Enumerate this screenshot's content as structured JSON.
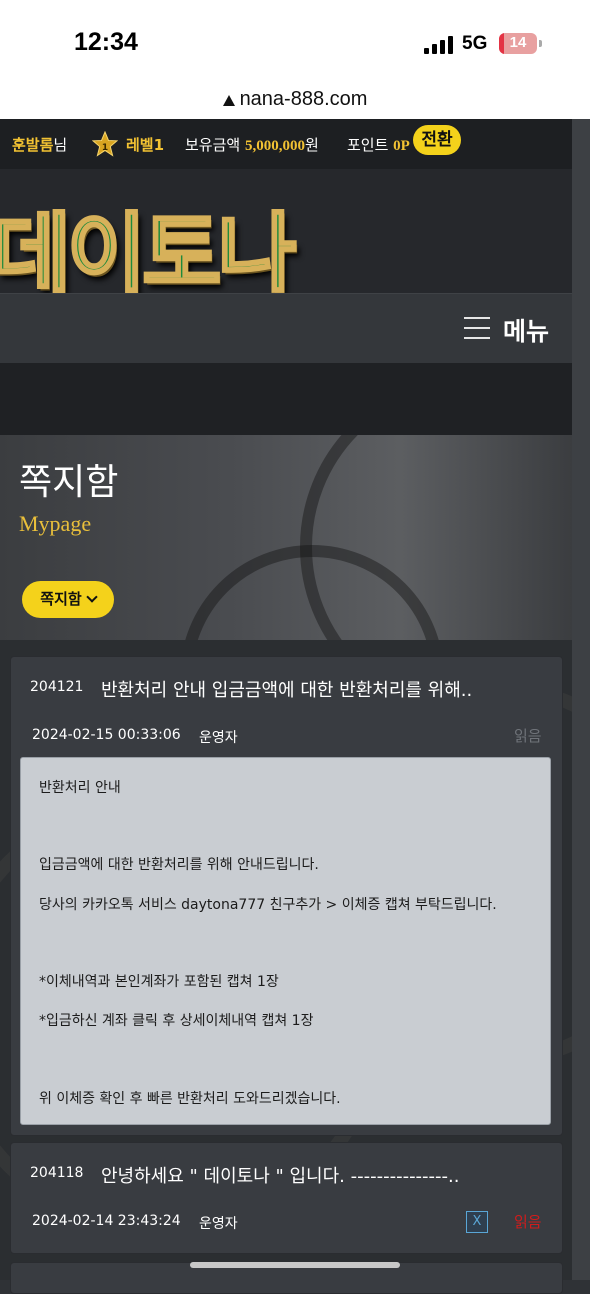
{
  "status_bar": {
    "time": "12:34",
    "network": "5G",
    "battery": "14",
    "battery_level": 0.14,
    "battery_color": "#e33344"
  },
  "browser": {
    "url": "nana-888.com"
  },
  "userbar": {
    "username": "훈발롬",
    "username_suffix": "님",
    "level_badge": "1",
    "level": "레벨1",
    "holding_label": "보유금액 ",
    "holding_value": "5,000,000",
    "holding_unit": "원",
    "point_label": "포인트 ",
    "point_value": "0P",
    "convert_button": "전환"
  },
  "header": {
    "logo_text": "데이토나",
    "menu_label": "메뉴"
  },
  "hero": {
    "title": "쪽지함",
    "subtitle": "Mypage",
    "dropdown_label": "쪽지함"
  },
  "messages": [
    {
      "id": "204121",
      "title": "반환처리 안내 입금금액에 대한 반환처리를 위해..",
      "date": "2024-02-15 00:33:06",
      "sender": "운영자",
      "status": "읽음",
      "status_color": "#6f7379",
      "body": [
        "반환처리 안내",
        "입금금액에 대한 반환처리를 위해 안내드립니다.",
        "당사의 카카오톡 서비스 daytona777 친구추가 > 이체증 캡쳐 부탁드립니다.",
        "*이체내역과 본인계좌가 포함된 캡쳐 1장",
        "*입금하신 계좌 클릭 후 상세이체내역 캡쳐 1장",
        "위 이체증 확인 후 빠른 반환처리 도와드리겠습니다."
      ]
    },
    {
      "id": "204118",
      "title": "안녕하세요 \" 데이토나 \" 입니다. ---------------..",
      "date": "2024-02-14 23:43:24",
      "sender": "운영자",
      "delete_label": "X",
      "status": "읽음",
      "status_color": "#d01c1c"
    }
  ],
  "colors": {
    "accent_yellow": "#f4d21b",
    "gold_text": "#e9bf3b"
  }
}
